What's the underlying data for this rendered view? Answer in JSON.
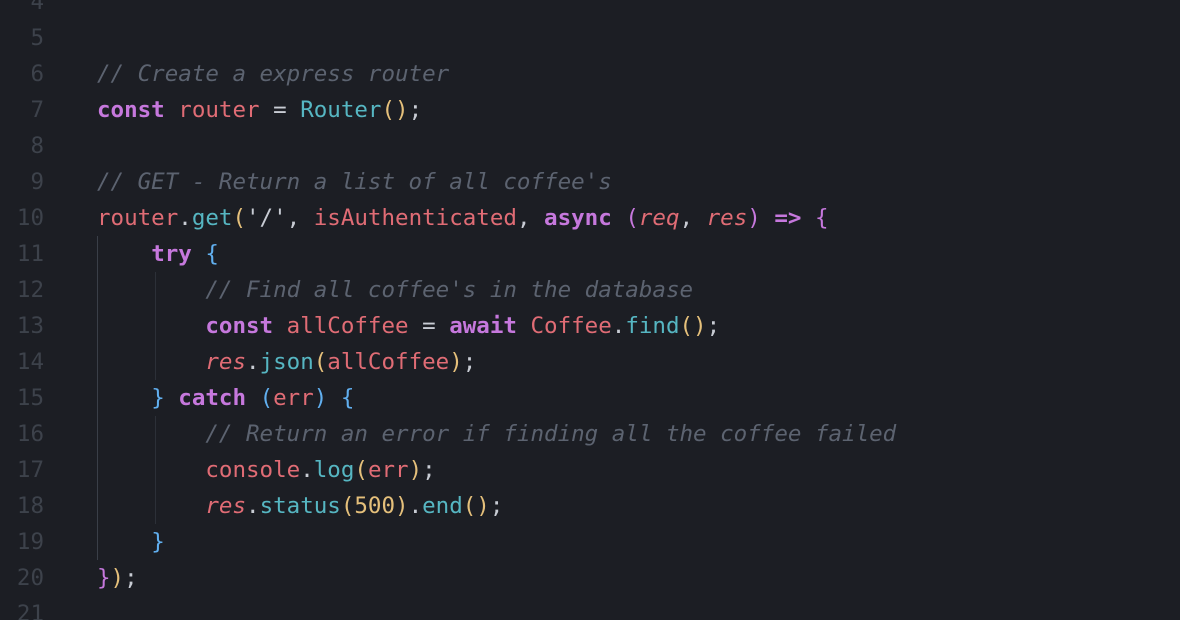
{
  "editor": {
    "language": "javascript",
    "theme": {
      "background": "#1c1e24",
      "line_number": "#3d424b",
      "keyword": "#c678dd",
      "variable": "#e06c75",
      "function": "#56b6c2",
      "bracket_level_1": "#e5c07b",
      "bracket_level_2": "#c678dd",
      "bracket_level_3": "#61afef",
      "comment": "#5c6370",
      "text": "#c8ccd4"
    },
    "lines": [
      {
        "number": "4",
        "tokens": []
      },
      {
        "number": "5",
        "tokens": []
      },
      {
        "number": "6",
        "tokens": [
          {
            "t": "// Create a express router",
            "c": "cm"
          }
        ]
      },
      {
        "number": "7",
        "tokens": [
          {
            "t": "const",
            "c": "kw"
          },
          {
            "t": " "
          },
          {
            "t": "router",
            "c": "var"
          },
          {
            "t": " = ",
            "c": "op"
          },
          {
            "t": "Router",
            "c": "fn"
          },
          {
            "t": "()",
            "c": "b1"
          },
          {
            "t": ";",
            "c": "punct"
          }
        ]
      },
      {
        "number": "8",
        "tokens": []
      },
      {
        "number": "9",
        "tokens": [
          {
            "t": "// GET - Return a list of all coffee's",
            "c": "cm"
          }
        ]
      },
      {
        "number": "10",
        "tokens": [
          {
            "t": "router",
            "c": "var"
          },
          {
            "t": ".",
            "c": "punct"
          },
          {
            "t": "get",
            "c": "fn"
          },
          {
            "t": "(",
            "c": "b1"
          },
          {
            "t": "'/'",
            "c": "str"
          },
          {
            "t": ", ",
            "c": "punct"
          },
          {
            "t": "isAuthenticated",
            "c": "var"
          },
          {
            "t": ", ",
            "c": "punct"
          },
          {
            "t": "async",
            "c": "kw"
          },
          {
            "t": " "
          },
          {
            "t": "(",
            "c": "b2"
          },
          {
            "t": "req",
            "c": "param"
          },
          {
            "t": ", ",
            "c": "punct"
          },
          {
            "t": "res",
            "c": "param"
          },
          {
            "t": ")",
            "c": "b2"
          },
          {
            "t": " "
          },
          {
            "t": "=>",
            "c": "arrow"
          },
          {
            "t": " "
          },
          {
            "t": "{",
            "c": "b2"
          }
        ]
      },
      {
        "number": "11",
        "tokens": [
          {
            "t": "    "
          },
          {
            "t": "try",
            "c": "kw"
          },
          {
            "t": " "
          },
          {
            "t": "{",
            "c": "b3"
          }
        ]
      },
      {
        "number": "12",
        "tokens": [
          {
            "t": "        "
          },
          {
            "t": "// Find all coffee's in the database",
            "c": "cm"
          }
        ]
      },
      {
        "number": "13",
        "tokens": [
          {
            "t": "        "
          },
          {
            "t": "const",
            "c": "kw"
          },
          {
            "t": " "
          },
          {
            "t": "allCoffee",
            "c": "var"
          },
          {
            "t": " = ",
            "c": "op"
          },
          {
            "t": "await",
            "c": "kw"
          },
          {
            "t": " "
          },
          {
            "t": "Coffee",
            "c": "var"
          },
          {
            "t": ".",
            "c": "punct"
          },
          {
            "t": "find",
            "c": "fn"
          },
          {
            "t": "()",
            "c": "b1"
          },
          {
            "t": ";",
            "c": "punct"
          }
        ]
      },
      {
        "number": "14",
        "tokens": [
          {
            "t": "        "
          },
          {
            "t": "res",
            "c": "param"
          },
          {
            "t": ".",
            "c": "punct"
          },
          {
            "t": "json",
            "c": "fn"
          },
          {
            "t": "(",
            "c": "b1"
          },
          {
            "t": "allCoffee",
            "c": "var"
          },
          {
            "t": ")",
            "c": "b1"
          },
          {
            "t": ";",
            "c": "punct"
          }
        ]
      },
      {
        "number": "15",
        "tokens": [
          {
            "t": "    "
          },
          {
            "t": "}",
            "c": "b3"
          },
          {
            "t": " "
          },
          {
            "t": "catch",
            "c": "kw"
          },
          {
            "t": " "
          },
          {
            "t": "(",
            "c": "b3"
          },
          {
            "t": "err",
            "c": "var"
          },
          {
            "t": ")",
            "c": "b3"
          },
          {
            "t": " "
          },
          {
            "t": "{",
            "c": "b3"
          }
        ]
      },
      {
        "number": "16",
        "tokens": [
          {
            "t": "        "
          },
          {
            "t": "// Return an error if finding all the coffee failed",
            "c": "cm"
          }
        ]
      },
      {
        "number": "17",
        "tokens": [
          {
            "t": "        "
          },
          {
            "t": "console",
            "c": "var"
          },
          {
            "t": ".",
            "c": "punct"
          },
          {
            "t": "log",
            "c": "fn"
          },
          {
            "t": "(",
            "c": "b1"
          },
          {
            "t": "err",
            "c": "var"
          },
          {
            "t": ")",
            "c": "b1"
          },
          {
            "t": ";",
            "c": "punct"
          }
        ]
      },
      {
        "number": "18",
        "tokens": [
          {
            "t": "        "
          },
          {
            "t": "res",
            "c": "param"
          },
          {
            "t": ".",
            "c": "punct"
          },
          {
            "t": "status",
            "c": "fn"
          },
          {
            "t": "(",
            "c": "b1"
          },
          {
            "t": "500",
            "c": "num"
          },
          {
            "t": ")",
            "c": "b1"
          },
          {
            "t": ".",
            "c": "punct"
          },
          {
            "t": "end",
            "c": "fn"
          },
          {
            "t": "()",
            "c": "b1"
          },
          {
            "t": ";",
            "c": "punct"
          }
        ]
      },
      {
        "number": "19",
        "tokens": [
          {
            "t": "    "
          },
          {
            "t": "}",
            "c": "b3"
          }
        ]
      },
      {
        "number": "20",
        "tokens": [
          {
            "t": "}",
            "c": "b2"
          },
          {
            "t": ")",
            "c": "b1"
          },
          {
            "t": ";",
            "c": "punct"
          }
        ]
      },
      {
        "number": "21",
        "tokens": []
      }
    ]
  }
}
